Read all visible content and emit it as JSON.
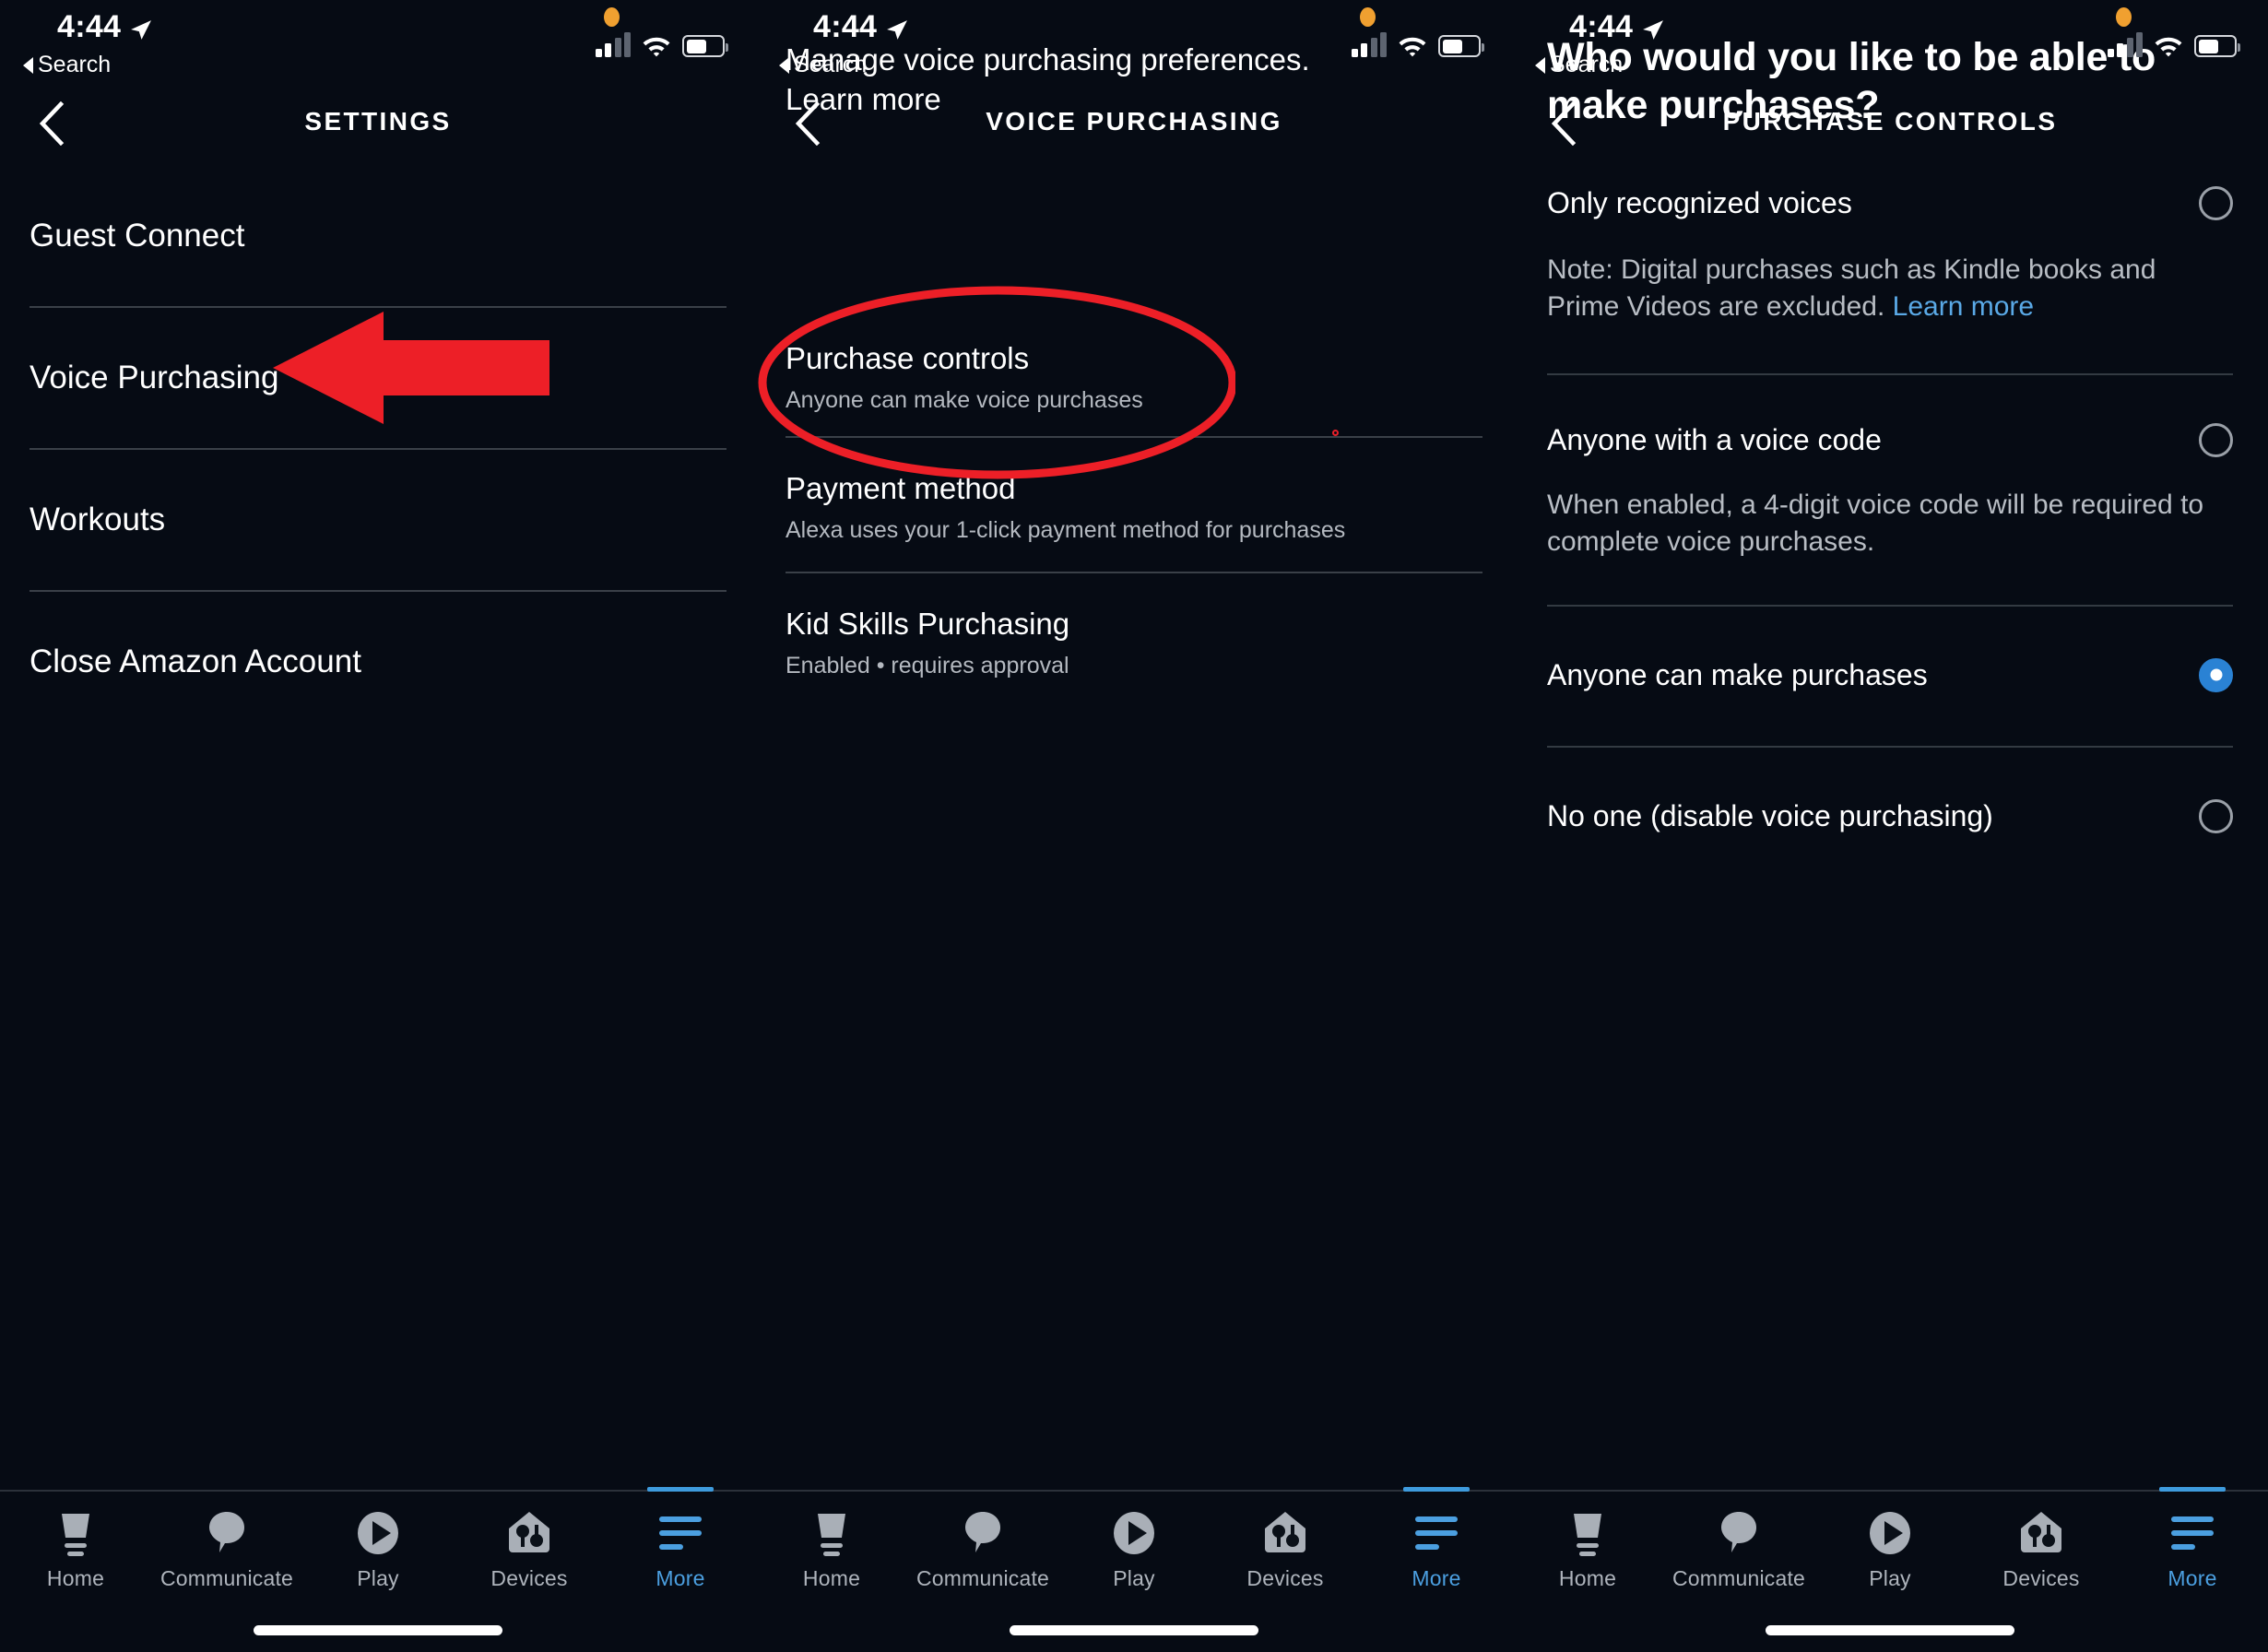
{
  "status_bar": {
    "time": "4:44",
    "back_label": "Search",
    "location_icon": "location-arrow-icon",
    "signal_icon": "cellular-signal-icon",
    "wifi_icon": "wifi-icon",
    "battery_icon": "battery-icon",
    "recording_indicator": "orange-dot-indicator"
  },
  "panels": [
    {
      "id": "settings",
      "nav": {
        "title": "SETTINGS",
        "back_icon": "chevron-left-icon"
      },
      "items": [
        {
          "title": "Guest Connect"
        },
        {
          "title": "Voice Purchasing"
        },
        {
          "title": "Workouts"
        },
        {
          "title": "Close Amazon Account"
        }
      ],
      "annotation": {
        "type": "red-arrow-left",
        "color": "#ed1f27",
        "points_at": "Voice Purchasing"
      }
    },
    {
      "id": "voice-purchasing",
      "nav": {
        "title": "VOICE PURCHASING",
        "back_icon": "chevron-left-icon"
      },
      "lead": {
        "text": "Manage voice purchasing preferences.",
        "link": "Learn more"
      },
      "items": [
        {
          "title": "Purchase controls",
          "subtitle": "Anyone can make voice purchases"
        },
        {
          "title": "Payment method",
          "subtitle": "Alexa uses your 1-click payment method for purchases"
        },
        {
          "title": "Kid Skills Purchasing",
          "subtitle": "Enabled • requires approval"
        }
      ],
      "annotation": {
        "type": "red-ellipse",
        "color": "#ed1f27",
        "circles": "Purchase controls"
      }
    },
    {
      "id": "purchase-controls",
      "nav": {
        "title": "PURCHASE CONTROLS",
        "back_icon": "chevron-left-icon"
      },
      "heading": "Who would you like to be able to make purchases?",
      "options": [
        {
          "label": "Only recognized voices",
          "selected": false,
          "note": "Note: Digital purchases such as Kindle books and Prime Videos are excluded.",
          "note_link": "Learn more"
        },
        {
          "label": "Anyone with a voice code",
          "selected": false,
          "note": "When enabled, a 4-digit voice code will be required to complete voice purchases.",
          "note_link": ""
        },
        {
          "label": "Anyone can make purchases",
          "selected": true,
          "note": "",
          "note_link": ""
        },
        {
          "label": "No one (disable voice purchasing)",
          "selected": false,
          "note": "",
          "note_link": ""
        }
      ]
    }
  ],
  "tabbar": {
    "items": [
      {
        "label": "Home",
        "icon": "echo-device-icon",
        "active": false
      },
      {
        "label": "Communicate",
        "icon": "speech-bubble-icon",
        "active": false
      },
      {
        "label": "Play",
        "icon": "play-circle-icon",
        "active": false
      },
      {
        "label": "Devices",
        "icon": "house-devices-icon",
        "active": false
      },
      {
        "label": "More",
        "icon": "hamburger-menu-icon",
        "active": true
      }
    ],
    "active_color": "#4b9fe0",
    "inactive_color": "#aeb4bc"
  }
}
